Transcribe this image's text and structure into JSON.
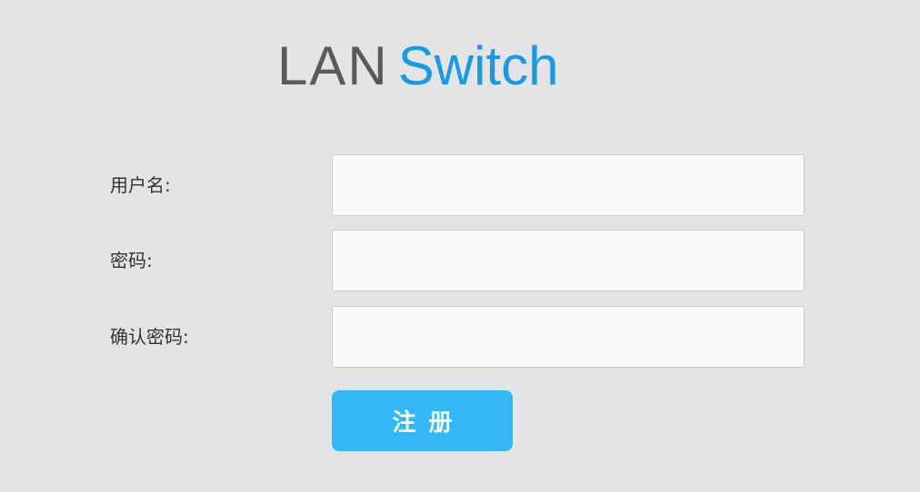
{
  "logo": {
    "part1": "LAN",
    "part2": "Switch"
  },
  "form": {
    "username_label": "用户名:",
    "username_value": "",
    "password_label": "密码:",
    "password_value": "",
    "confirm_label": "确认密码:",
    "confirm_value": "",
    "register_label": "注册"
  },
  "colors": {
    "background": "#e3e4e6",
    "logo_gray": "#5a5a5a",
    "logo_blue": "#1b9ae2",
    "button": "#34b8f5"
  }
}
